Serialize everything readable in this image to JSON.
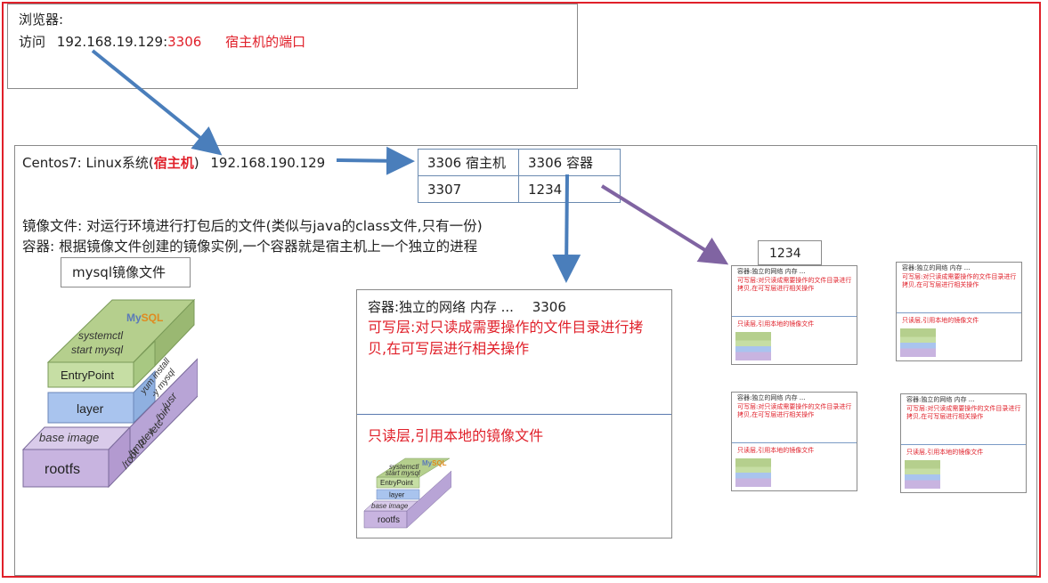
{
  "browser": {
    "title": "浏览器:",
    "access_label": "访问",
    "address_ip": "192.168.19.129:",
    "address_port": "3306",
    "port_note": "宿主机的端口"
  },
  "host": {
    "label_prefix": "Centos7: Linux系统(",
    "label_emphasis": "宿主机",
    "label_suffix": ")",
    "ip": "192.168.190.129",
    "image_desc": "镜像文件: 对运行环境进行打包后的文件(类似与java的class文件,只有一份)",
    "container_desc": "容器: 根据镜像文件创建的镜像实例,一个容器就是宿主机上一个独立的进程",
    "image_box_label": "mysql镜像文件"
  },
  "port_table": {
    "rows": [
      [
        "3306 宿主机",
        "3306 容器"
      ],
      [
        "3307",
        "1234"
      ]
    ]
  },
  "container": {
    "title": "容器:独立的网络 内存 ...",
    "port": "3306",
    "writable_layer": "可写层:对只读成需要操作的文件目录进行拷贝,在可写层进行相关操作",
    "readonly_layer": "只读层,引用本地的镜像文件"
  },
  "second_container_port": "1234",
  "image_stack": {
    "rootfs": "rootfs",
    "base_image": "base image",
    "layer": "layer",
    "entrypoint": "EntryPoint",
    "systemctl": "systemctl",
    "start_mysql": "start  mysql",
    "yum_install": "yum install",
    "y_mysql": "-y mysql",
    "usr": "/usr",
    "bin": "/bin",
    "etc": "/etc",
    "dev": "/dev",
    "tmp": "/tmp",
    "root": "/root",
    "brand_my": "My",
    "brand_sql": "SQL"
  },
  "colors": {
    "border_red": "#e0202a",
    "arrow_blue": "#4a7ebb",
    "arrow_purple": "#8064a2",
    "rootfs_fill": "#c8b4e0",
    "layer_fill": "#a9c4ee",
    "entrypoint_fill": "#c6dea4",
    "systemctl_fill": "#b5cf8d"
  }
}
